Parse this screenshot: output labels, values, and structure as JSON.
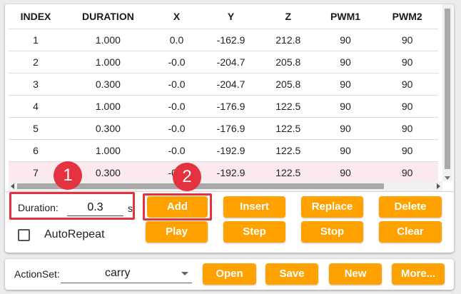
{
  "table": {
    "columns": [
      "INDEX",
      "DURATION",
      "X",
      "Y",
      "Z",
      "PWM1",
      "PWM2"
    ],
    "rows": [
      [
        "1",
        "1.000",
        "0.0",
        "-162.9",
        "212.8",
        "90",
        "90"
      ],
      [
        "2",
        "1.000",
        "-0.0",
        "-204.7",
        "205.8",
        "90",
        "90"
      ],
      [
        "3",
        "0.300",
        "-0.0",
        "-204.7",
        "205.8",
        "90",
        "90"
      ],
      [
        "4",
        "1.000",
        "-0.0",
        "-176.9",
        "122.5",
        "90",
        "90"
      ],
      [
        "5",
        "0.300",
        "-0.0",
        "-176.9",
        "122.5",
        "90",
        "90"
      ],
      [
        "6",
        "1.000",
        "-0.0",
        "-192.9",
        "122.5",
        "90",
        "90"
      ],
      [
        "7",
        "0.300",
        "-0.0",
        "-192.9",
        "122.5",
        "90",
        "90"
      ]
    ],
    "selected_row_index": 6
  },
  "duration": {
    "label": "Duration:",
    "value": "0.3",
    "unit": "s"
  },
  "autorepeat": {
    "label": "AutoRepeat",
    "checked": false
  },
  "buttons": {
    "add": "Add",
    "insert": "Insert",
    "replace": "Replace",
    "delete": "Delete",
    "play": "Play",
    "step": "Step",
    "stop": "Stop",
    "clear": "Clear"
  },
  "badges": {
    "one": "1",
    "two": "2"
  },
  "actionset": {
    "label": "ActionSet:",
    "value": "carry",
    "open": "Open",
    "save": "Save",
    "new": "New",
    "more": "More..."
  },
  "colors": {
    "accent": "#ffa200",
    "highlight": "#e53240",
    "selected_row": "#fbe9ee"
  }
}
